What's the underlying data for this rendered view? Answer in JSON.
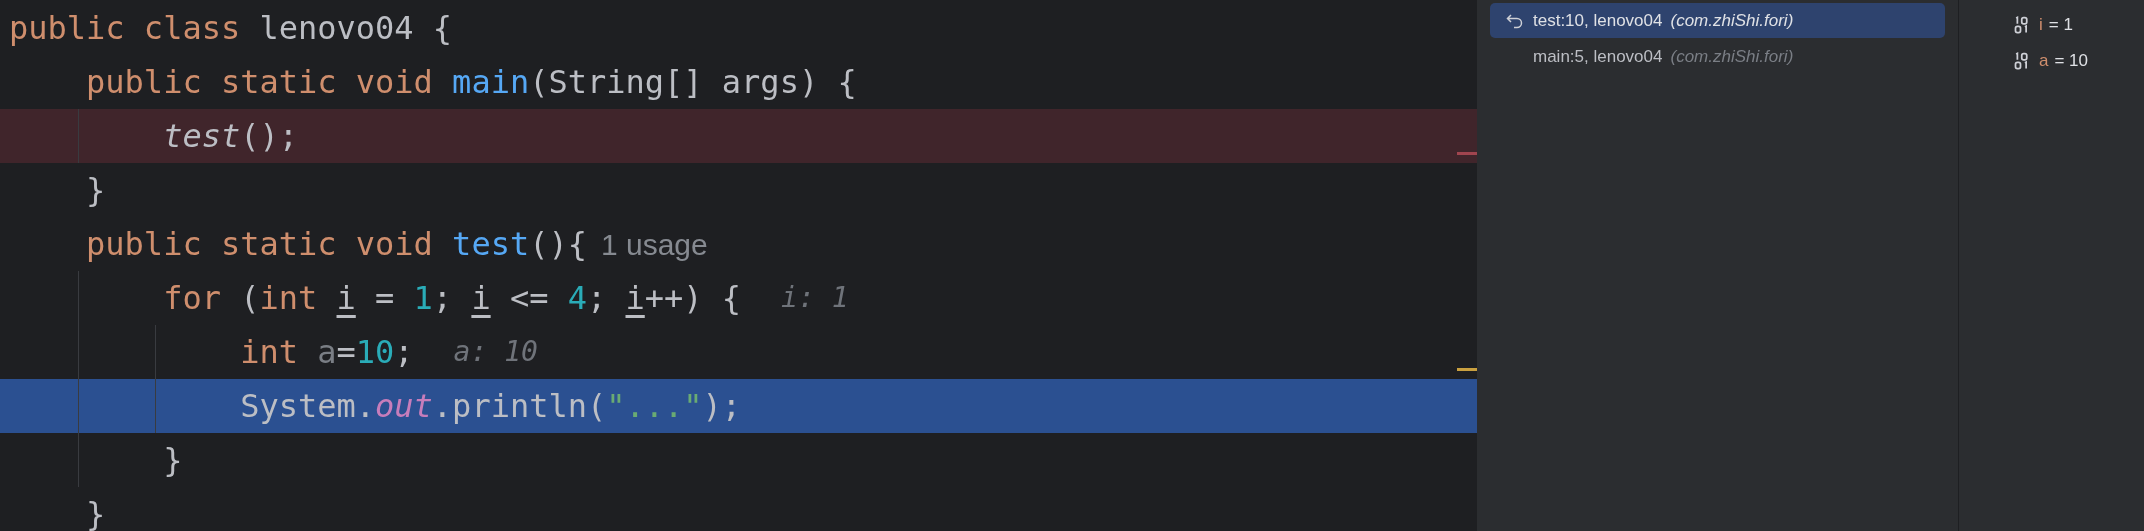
{
  "editor": {
    "lines": [
      {
        "breakpoint": false,
        "execution": false,
        "tokens": [
          {
            "text": "public class ",
            "kind": "keyword"
          },
          {
            "text": "lenovo04 {",
            "kind": "plain"
          }
        ]
      },
      {
        "breakpoint": false,
        "execution": false,
        "tokens": [
          {
            "text": "    public static void ",
            "kind": "keyword"
          },
          {
            "text": "main",
            "kind": "method"
          },
          {
            "text": "(String[] args) {",
            "kind": "plain"
          }
        ]
      },
      {
        "breakpoint": true,
        "execution": false,
        "error_mark": true,
        "tokens": [
          {
            "text": "        test",
            "kind": "call"
          },
          {
            "text": "();",
            "kind": "plain"
          }
        ]
      },
      {
        "breakpoint": false,
        "execution": false,
        "tokens": [
          {
            "text": "    }",
            "kind": "plain"
          }
        ]
      },
      {
        "breakpoint": false,
        "execution": false,
        "tokens": [
          {
            "text": "    public static void ",
            "kind": "keyword"
          },
          {
            "text": "test",
            "kind": "method"
          },
          {
            "text": "(){",
            "kind": "plain"
          },
          {
            "text": "1 usage",
            "kind": "usage"
          }
        ]
      },
      {
        "breakpoint": false,
        "execution": false,
        "tokens": [
          {
            "text": "        for ",
            "kind": "keyword"
          },
          {
            "text": "(",
            "kind": "plain"
          },
          {
            "text": "int ",
            "kind": "keyword"
          },
          {
            "text": "i",
            "kind": "loopvar"
          },
          {
            "text": " = ",
            "kind": "plain"
          },
          {
            "text": "1",
            "kind": "number"
          },
          {
            "text": "; ",
            "kind": "plain"
          },
          {
            "text": "i",
            "kind": "loopvar"
          },
          {
            "text": " <= ",
            "kind": "plain"
          },
          {
            "text": "4",
            "kind": "number"
          },
          {
            "text": "; ",
            "kind": "plain"
          },
          {
            "text": "i",
            "kind": "loopvar"
          },
          {
            "text": "++) {",
            "kind": "plain"
          },
          {
            "text": "i: 1",
            "kind": "value"
          }
        ]
      },
      {
        "breakpoint": false,
        "execution": false,
        "warning_mark": true,
        "tokens": [
          {
            "text": "            int ",
            "kind": "keyword"
          },
          {
            "text": "a",
            "kind": "unused"
          },
          {
            "text": "=",
            "kind": "plain"
          },
          {
            "text": "10",
            "kind": "number"
          },
          {
            "text": ";",
            "kind": "plain"
          },
          {
            "text": "a: 10",
            "kind": "value"
          }
        ]
      },
      {
        "breakpoint": false,
        "execution": true,
        "tokens": [
          {
            "text": "            System.",
            "kind": "plain"
          },
          {
            "text": "out",
            "kind": "field"
          },
          {
            "text": ".println(",
            "kind": "plain"
          },
          {
            "text": "\"...\"",
            "kind": "string"
          },
          {
            "text": ");",
            "kind": "plain"
          }
        ]
      },
      {
        "breakpoint": false,
        "execution": false,
        "tokens": [
          {
            "text": "        }",
            "kind": "plain"
          }
        ]
      },
      {
        "breakpoint": false,
        "execution": false,
        "tokens": [
          {
            "text": "    }",
            "kind": "plain"
          }
        ]
      }
    ]
  },
  "frames": [
    {
      "location": "test:10, lenovo04",
      "package": "(com.zhiShi.fori)",
      "selected": true
    },
    {
      "location": "main:5, lenovo04",
      "package": "(com.zhiShi.fori)",
      "selected": false
    }
  ],
  "variables": [
    {
      "name": "i",
      "value": "= 1"
    },
    {
      "name": "a",
      "value": "= 10"
    }
  ]
}
